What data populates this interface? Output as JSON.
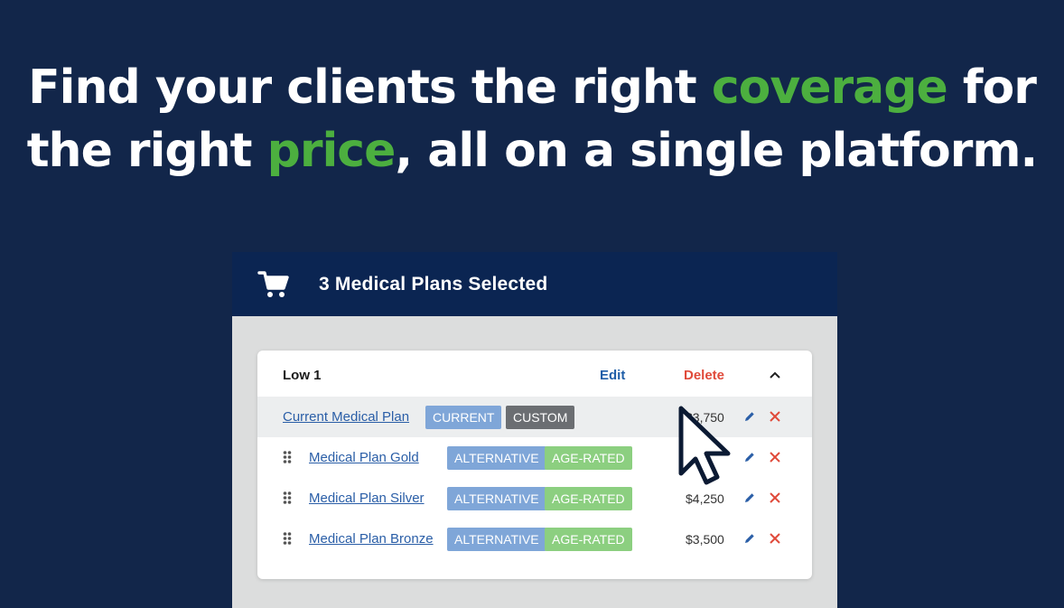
{
  "headline": {
    "line1_pre": "Find your clients the right ",
    "line1_accent": "coverage",
    "line1_post": " for",
    "line2_pre": "the right ",
    "line2_accent": "price",
    "line2_post": ", all on a single platform."
  },
  "panel": {
    "title": "3 Medical Plans Selected",
    "icon": "cart-icon"
  },
  "card": {
    "group_name": "Low 1",
    "edit_label": "Edit",
    "delete_label": "Delete",
    "rows": [
      {
        "name": "Current Medical Plan",
        "badge1": "CURRENT",
        "badge2": "CUSTOM",
        "price": "$3,750"
      },
      {
        "name": "Medical Plan Gold",
        "badge1": "ALTERNATIVE",
        "badge2": "AGE-RATED",
        "price": ""
      },
      {
        "name": "Medical Plan Silver",
        "badge1": "ALTERNATIVE",
        "badge2": "AGE-RATED",
        "price": "$4,250"
      },
      {
        "name": "Medical Plan Bronze",
        "badge1": "ALTERNATIVE",
        "badge2": "AGE-RATED",
        "price": "$3,500"
      }
    ]
  },
  "colors": {
    "background": "#12264a",
    "accent_green": "#4caf3f",
    "header_navy": "#0b2552",
    "link_blue": "#2a5ea7",
    "delete_red": "#e04a3a"
  }
}
